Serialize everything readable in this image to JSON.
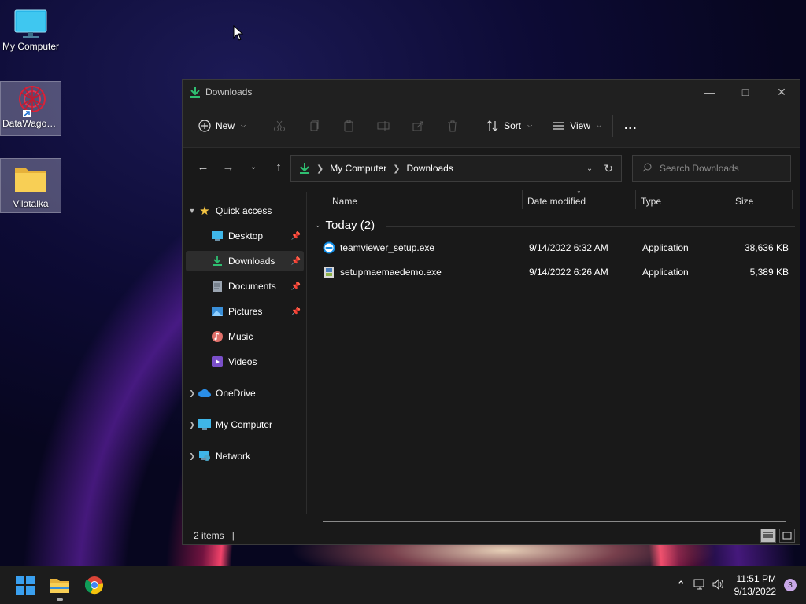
{
  "desktop": {
    "icons": [
      {
        "label": "My Computer"
      },
      {
        "label": "DataWagon..."
      },
      {
        "label": "Vilatalka"
      }
    ]
  },
  "window": {
    "title": "Downloads",
    "toolbar": {
      "new_label": "New",
      "sort_label": "Sort",
      "view_label": "View",
      "more_label": "..."
    },
    "address": {
      "crumbs": [
        "My Computer",
        "Downloads"
      ]
    },
    "search": {
      "placeholder": "Search Downloads"
    },
    "sidebar": {
      "quick_access": "Quick access",
      "items": [
        {
          "label": "Desktop",
          "pinned": true
        },
        {
          "label": "Downloads",
          "pinned": true
        },
        {
          "label": "Documents",
          "pinned": true
        },
        {
          "label": "Pictures",
          "pinned": true
        },
        {
          "label": "Music",
          "pinned": false
        },
        {
          "label": "Videos",
          "pinned": false
        }
      ],
      "onedrive": "OneDrive",
      "my_computer": "My Computer",
      "network": "Network"
    },
    "columns": {
      "name": "Name",
      "date": "Date modified",
      "type": "Type",
      "size": "Size"
    },
    "group_label": "Today (2)",
    "files": [
      {
        "name": "teamviewer_setup.exe",
        "date": "9/14/2022 6:32 AM",
        "type": "Application",
        "size": "38,636 KB"
      },
      {
        "name": "setupmaemaedemo.exe",
        "date": "9/14/2022 6:26 AM",
        "type": "Application",
        "size": "5,389 KB"
      }
    ],
    "status": {
      "items": "2 items"
    }
  },
  "taskbar": {
    "time": "11:51 PM",
    "date": "9/13/2022",
    "notifications": "3"
  },
  "colors": {
    "accent_green": "#2fbf71",
    "folder_yellow": "#f5c542",
    "window_bg": "#191919"
  }
}
